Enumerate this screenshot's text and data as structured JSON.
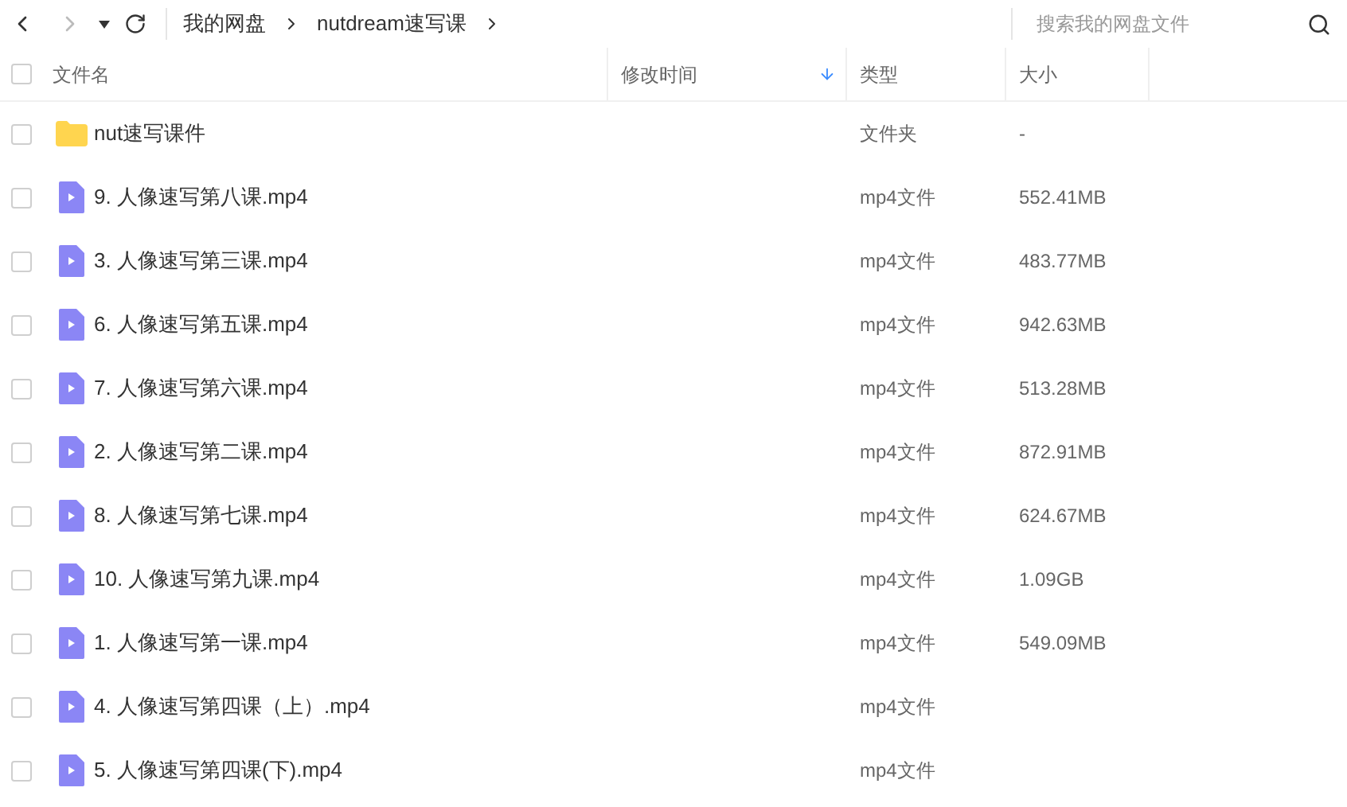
{
  "breadcrumb": [
    "我的网盘",
    "nutdream速写课"
  ],
  "search": {
    "placeholder": "搜索我的网盘文件"
  },
  "select_all": {
    "checked": false
  },
  "columns": [
    {
      "label": "文件名",
      "sorted": false
    },
    {
      "label": "修改时间",
      "sorted": true
    },
    {
      "label": "类型",
      "sorted": false
    },
    {
      "label": "大小",
      "sorted": false
    }
  ],
  "rows": [
    {
      "kind": "folder",
      "name": "nut速写课件",
      "type": "文件夹",
      "size": "-",
      "checked": false
    },
    {
      "kind": "video",
      "name": "9. 人像速写第八课.mp4",
      "type": "mp4文件",
      "size": "552.41MB",
      "checked": false
    },
    {
      "kind": "video",
      "name": "3. 人像速写第三课.mp4",
      "type": "mp4文件",
      "size": "483.77MB",
      "checked": false
    },
    {
      "kind": "video",
      "name": "6. 人像速写第五课.mp4",
      "type": "mp4文件",
      "size": "942.63MB",
      "checked": false
    },
    {
      "kind": "video",
      "name": "7. 人像速写第六课.mp4",
      "type": "mp4文件",
      "size": "513.28MB",
      "checked": false
    },
    {
      "kind": "video",
      "name": "2. 人像速写第二课.mp4",
      "type": "mp4文件",
      "size": "872.91MB",
      "checked": false
    },
    {
      "kind": "video",
      "name": "8. 人像速写第七课.mp4",
      "type": "mp4文件",
      "size": "624.67MB",
      "checked": false
    },
    {
      "kind": "video",
      "name": "10. 人像速写第九课.mp4",
      "type": "mp4文件",
      "size": "1.09GB",
      "checked": false
    },
    {
      "kind": "video",
      "name": "1. 人像速写第一课.mp4",
      "type": "mp4文件",
      "size": "549.09MB",
      "checked": false
    },
    {
      "kind": "video",
      "name": "4. 人像速写第四课（上）.mp4",
      "type": "mp4文件",
      "checked": false
    },
    {
      "kind": "video",
      "name": "5. 人像速写第四课(下).mp4",
      "type": "mp4文件",
      "checked": false
    }
  ]
}
